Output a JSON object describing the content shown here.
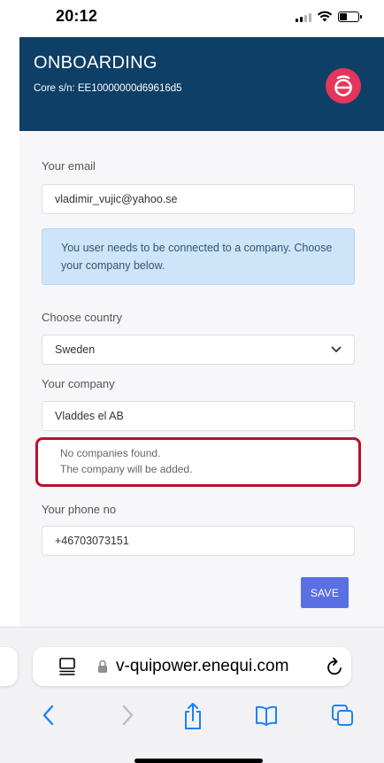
{
  "status_bar": {
    "time": "20:12",
    "battery_level": 0.4
  },
  "header": {
    "title": "ONBOARDING",
    "core_sn_label": "Core s/n: EE10000000d69616d5"
  },
  "form": {
    "email_label": "Your email",
    "email_value": "vladimir_vujic@yahoo.se",
    "info_message": "You user needs to be connected to a company. Choose your company below.",
    "country_label": "Choose country",
    "country_value": "Sweden",
    "company_label": "Your company",
    "company_value": "Vladdes el AB",
    "notice_line1": "No companies found.",
    "notice_line2": "The company will be added.",
    "phone_label": "Your phone no",
    "phone_value": "+46703073151",
    "save_label": "SAVE"
  },
  "browser": {
    "url": "v-quipower.enequi.com",
    "icons": [
      "reader-icon",
      "lock-icon",
      "reload-icon",
      "back-icon",
      "forward-icon",
      "share-icon",
      "bookmarks-icon",
      "tabs-icon"
    ]
  },
  "colors": {
    "header_bg": "#0e3f66",
    "logo_bg": "#e4365a",
    "info_bg": "#cde4f9",
    "notice_border": "#b8102f",
    "save_button": "#5b6fe5",
    "ios_blue": "#1a82fb"
  }
}
